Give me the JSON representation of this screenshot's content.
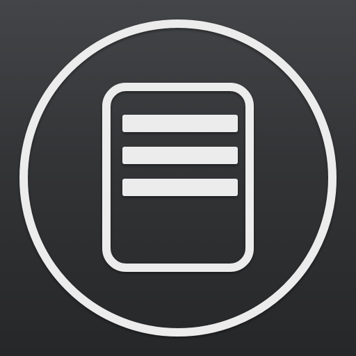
{
  "icon": {
    "name": "document-list-icon",
    "colors": {
      "background_top": "#444548",
      "background_bottom": "#262729",
      "foreground": "#ececec"
    }
  }
}
